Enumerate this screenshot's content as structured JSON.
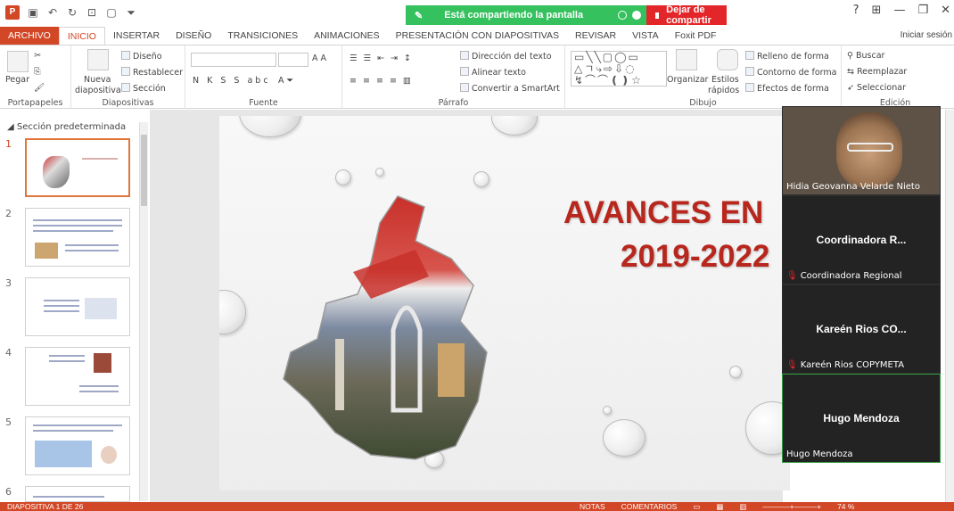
{
  "titlebar": {
    "help": "?",
    "share_banner": "Está compartiendo la pantalla",
    "stop_share": "Dejar de compartir"
  },
  "tabs": [
    "ARCHIVO",
    "INICIO",
    "INSERTAR",
    "DISEÑO",
    "TRANSICIONES",
    "ANIMACIONES",
    "PRESENTACIÓN CON DIAPOSITIVAS",
    "REVISAR",
    "VISTA",
    "Foxit PDF"
  ],
  "signin": "Iniciar sesión",
  "ribbon": {
    "paste": "Pegar",
    "new_slide_1": "Nueva",
    "new_slide_2": "diapositiva",
    "layout": "Diseño",
    "reset": "Restablecer",
    "section": "Sección",
    "text_direction": "Dirección del texto",
    "align_text": "Alinear texto",
    "smartart": "Convertir a SmartArt",
    "arrange": "Organizar",
    "styles_1": "Estilos",
    "styles_2": "rápidos",
    "fill": "Relleno de forma",
    "outline": "Contorno de forma",
    "effects": "Efectos de forma",
    "find": "Buscar",
    "replace": "Reemplazar",
    "select": "Seleccionar",
    "font_buttons": "N K S S abc",
    "groups": {
      "clipboard": "Portapapeles",
      "slides": "Diapositivas",
      "font": "Fuente",
      "paragraph": "Párrafo",
      "drawing": "Dibujo",
      "editing": "Edición"
    }
  },
  "pane": {
    "section_name": "Sección predeterminada",
    "slide_numbers": [
      "1",
      "2",
      "3",
      "4",
      "5",
      "6"
    ]
  },
  "slide": {
    "title_line1": "AVANCES EN",
    "title_line2": "2019-2022"
  },
  "participants": [
    {
      "name": "Hidia Geovanna Velarde Nieto",
      "video": true
    },
    {
      "display": "Coordinadora R...",
      "name": "Coordinadora Regional",
      "muted": true
    },
    {
      "display": "Kareén Rios CO...",
      "name": "Kareén Rios COPYMETA",
      "muted": true
    },
    {
      "display": "Hugo Mendoza",
      "name": "Hugo Mendoza",
      "speaking": true
    }
  ],
  "statusbar": {
    "slide_info": "DIAPOSITIVA 1 DE 26",
    "notes": "NOTAS",
    "comments": "COMENTARIOS",
    "zoom": "74 %"
  }
}
